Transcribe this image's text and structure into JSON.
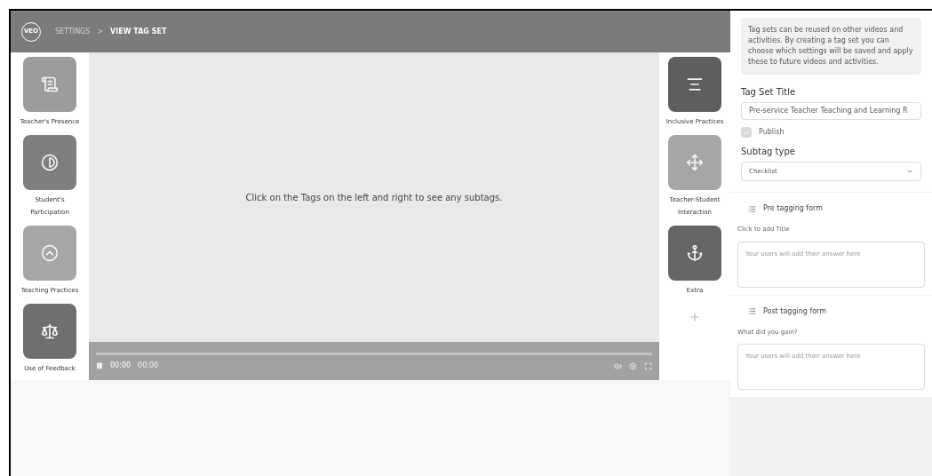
{
  "header": {
    "logo": "VEO",
    "breadcrumb": [
      {
        "label": "SETTINGS",
        "selected": false
      },
      {
        "label": "VIEW TAG SET",
        "selected": true
      }
    ],
    "separator": ">"
  },
  "left_tags": [
    {
      "label": "Teacher's Presence",
      "color": "#9c9c9c",
      "kind": "scroll"
    },
    {
      "label": "Student's Participation",
      "color": "#7f7f7f",
      "kind": "contrast"
    },
    {
      "label": "Teaching Practices",
      "color": "#a6a6a6",
      "kind": "chevron"
    },
    {
      "label": "Use of Feedback",
      "color": "#6f6f6f",
      "kind": "scale"
    }
  ],
  "right_tags": [
    {
      "label": "Inclusive Practices",
      "color": "#5e5e5e",
      "kind": "stack"
    },
    {
      "label": "Teacher-Student Interaction",
      "color": "#a6a6a6",
      "kind": "move"
    },
    {
      "label": "Extra",
      "color": "#666666",
      "kind": "anchor"
    }
  ],
  "video": {
    "message": "Click on the Tags on the left and right to see any subtags.",
    "level": 0,
    "current_time": "00:00",
    "duration": "00:00"
  },
  "panel": {
    "info": "Tag sets can be reused on other videos and activities. By creating a tag set you can choose which settings will be saved and apply these to future videos and activities.",
    "title_label": "Tag Set Title",
    "title_value": "Pre-service Teacher Teaching and Learning R",
    "publish": {
      "label": "Publish",
      "checked": true
    },
    "subtag_label": "Subtag type",
    "subtag_value": "Checklist",
    "forms": [
      {
        "heading": "Pre tagging form",
        "question": "Click to add Title",
        "placeholder": "Your users will add their answer here"
      },
      {
        "heading": "Post tagging form",
        "question": "What did you gain?",
        "placeholder": "Your users will add their answer here"
      }
    ]
  }
}
